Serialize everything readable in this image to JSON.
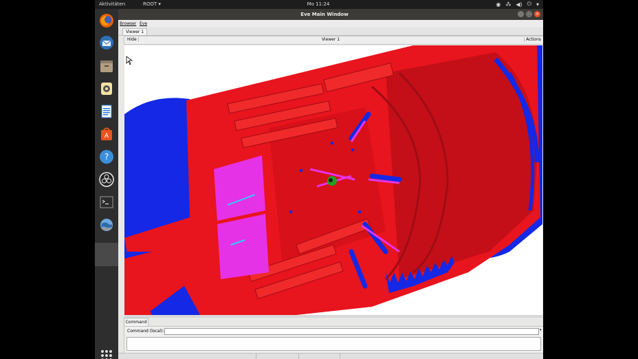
{
  "topbar": {
    "activities": "Aktivitäten",
    "app_menu": "ROOT ▾",
    "clock": "Mo 11:24"
  },
  "dock": {
    "items": [
      "firefox-icon",
      "thunderbird-icon",
      "files-icon",
      "rhythmbox-icon",
      "writer-icon",
      "software-icon",
      "help-icon",
      "obs-icon",
      "terminal-icon",
      "network-globe-icon"
    ]
  },
  "window": {
    "title": "Eve Main Window",
    "menus": [
      "Browser",
      "Eve"
    ],
    "tab": "Viewer 1",
    "viewer_bar": {
      "hide": "Hide",
      "title": "Viewer 1",
      "actions": "Actions"
    },
    "command_tab": "Command",
    "command_label": "Command (local):",
    "command_value": ""
  },
  "colors": {
    "detector_red": "#e8141e",
    "detector_blue": "#1428e6",
    "detector_magenta": "#e632e6",
    "close_button": "#e9542d"
  }
}
